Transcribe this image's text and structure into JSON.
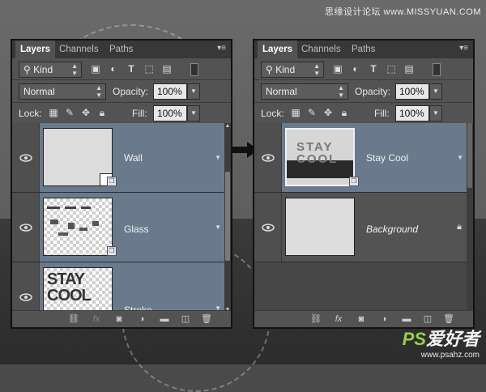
{
  "watermark_top": "思缘设计论坛 www.MISSYUAN.COM",
  "watermark_bottom": {
    "logo_ps": "PS",
    "logo_text": "爱好者",
    "url": "www.psahz.com"
  },
  "panels": {
    "left": {
      "tabs": [
        "Layers",
        "Channels",
        "Paths"
      ],
      "kind_label": "Kind",
      "blend_mode": "Normal",
      "opacity_label": "Opacity:",
      "opacity_value": "100%",
      "lock_label": "Lock:",
      "fill_label": "Fill:",
      "fill_value": "100%",
      "layers": [
        {
          "name": "Wall",
          "selected": true
        },
        {
          "name": "Glass",
          "selected": true
        },
        {
          "name": "Stroke",
          "selected": true
        }
      ]
    },
    "right": {
      "tabs": [
        "Layers",
        "Channels",
        "Paths"
      ],
      "kind_label": "Kind",
      "blend_mode": "Normal",
      "opacity_label": "Opacity:",
      "opacity_value": "100%",
      "lock_label": "Lock:",
      "fill_label": "Fill:",
      "fill_value": "100%",
      "layers": [
        {
          "name": "Stay  Cool",
          "selected": true
        },
        {
          "name": "Background",
          "selected": false,
          "locked": true
        }
      ]
    }
  },
  "thumb_text": "STAY COOL",
  "icons": {
    "filter_icons": [
      "image-filter-icon",
      "adjustment-filter-icon",
      "type-filter-icon",
      "shape-filter-icon",
      "smart-object-filter-icon"
    ],
    "lock_icons": [
      "lock-transparent-icon",
      "lock-paint-icon",
      "lock-position-icon",
      "lock-all-icon"
    ],
    "footer_icons": [
      "link-icon",
      "fx-icon",
      "mask-icon",
      "adjustment-icon",
      "folder-icon",
      "new-layer-icon",
      "trash-icon"
    ]
  },
  "colors": {
    "selected_layer": "#6a7a8c",
    "panel": "#535353",
    "tab_bar": "#383838"
  }
}
